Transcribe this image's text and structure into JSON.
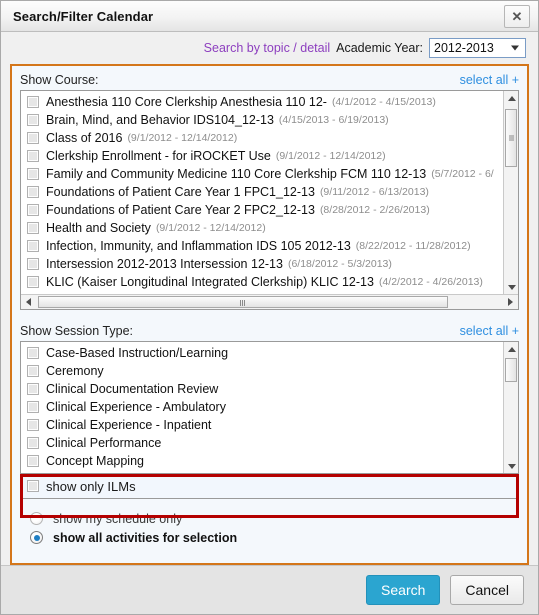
{
  "dialog": {
    "title": "Search/Filter Calendar",
    "close_icon": "close-icon"
  },
  "topbar": {
    "topic_link": "Search by topic / detail",
    "academic_year_label": "Academic Year:",
    "academic_year_value": "2012-2013"
  },
  "course_section": {
    "label": "Show Course:",
    "select_all": "select all +",
    "items": [
      {
        "name": "Anesthesia 110 Core Clerkship Anesthesia 110 12-",
        "dates": "(4/1/2012 - 4/15/2013)"
      },
      {
        "name": "Brain, Mind, and Behavior IDS104_12-13",
        "dates": "(4/15/2013 - 6/19/2013)"
      },
      {
        "name": "Class of 2016",
        "dates": "(9/1/2012 - 12/14/2012)"
      },
      {
        "name": "Clerkship Enrollment - for iROCKET Use",
        "dates": "(9/1/2012 - 12/14/2012)"
      },
      {
        "name": "Family and Community Medicine 110 Core Clerkship FCM 110 12-13",
        "dates": "(5/7/2012 - 6/"
      },
      {
        "name": "Foundations of Patient Care Year 1 FPC1_12-13",
        "dates": "(9/11/2012 - 6/13/2013)"
      },
      {
        "name": "Foundations of Patient Care Year 2 FPC2_12-13",
        "dates": "(8/28/2012 - 2/26/2013)"
      },
      {
        "name": "Health and Society",
        "dates": "(9/1/2012 - 12/14/2012)"
      },
      {
        "name": "Infection, Immunity, and Inflammation IDS 105 2012-13",
        "dates": "(8/22/2012 - 11/28/2012)"
      },
      {
        "name": "Intersession 2012-2013 Intersession 12-13",
        "dates": "(6/18/2012 - 5/3/2013)"
      },
      {
        "name": "KLIC (Kaiser Longitudinal Integrated Clerkship) KLIC 12-13",
        "dates": "(4/2/2012 - 4/26/2013)"
      }
    ]
  },
  "session_section": {
    "label": "Show Session Type:",
    "select_all": "select all +",
    "items": [
      {
        "name": "Case-Based Instruction/Learning"
      },
      {
        "name": "Ceremony"
      },
      {
        "name": "Clinical Documentation Review"
      },
      {
        "name": "Clinical Experience - Ambulatory"
      },
      {
        "name": "Clinical Experience - Inpatient"
      },
      {
        "name": "Clinical Performance"
      },
      {
        "name": "Concept Mapping"
      }
    ]
  },
  "ilm": {
    "label": "show only ILMs",
    "checked": false
  },
  "scope": {
    "options": [
      {
        "label": "show my schedule only",
        "selected": false
      },
      {
        "label": "show all activities for selection",
        "selected": true
      }
    ]
  },
  "footer": {
    "search_label": "Search",
    "cancel_label": "Cancel"
  },
  "colors": {
    "panel_border": "#d4761a",
    "highlight_box": "#b40000",
    "search_button": "#2ba5d0",
    "topic_link": "#8d3fbf",
    "select_all_link": "#2f8fe0"
  }
}
